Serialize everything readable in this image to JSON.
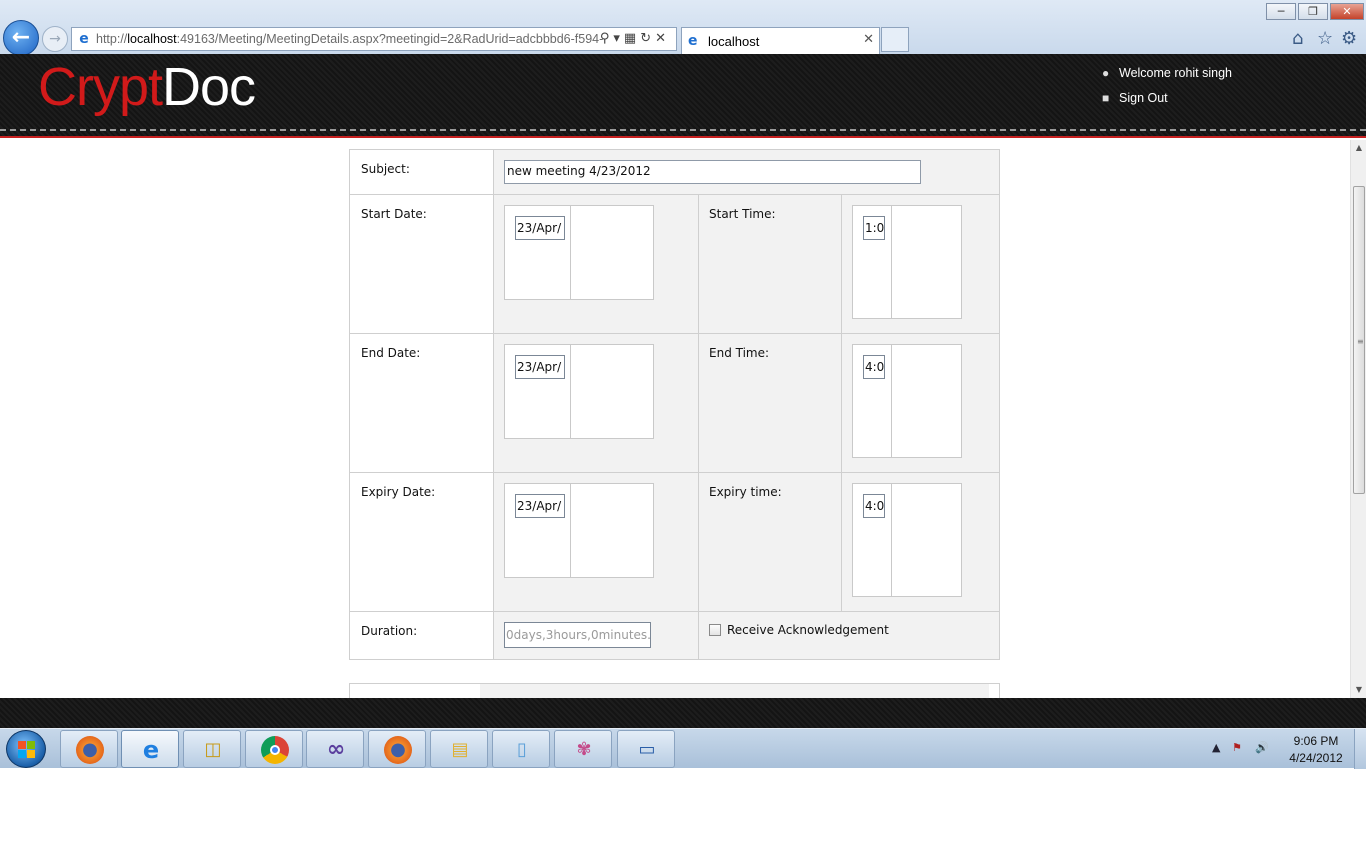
{
  "browser": {
    "url_prefix": "http://",
    "url_host": "localhost",
    "url_rest": ":49163/Meeting/MeetingDetails.aspx?meetingid=2&RadUrid=adcbbbd6-f594-",
    "tab_title": "localhost"
  },
  "header": {
    "logo_part1": "Crypt",
    "logo_part2": "Doc",
    "welcome": "Welcome rohit singh",
    "signout": "Sign Out"
  },
  "form": {
    "subject_label": "Subject:",
    "subject_value": "new meeting 4/23/2012",
    "start_date_label": "Start Date:",
    "start_date_value": "23/Apr/",
    "start_time_label": "Start Time:",
    "start_time_value": "1:0",
    "end_date_label": "End Date:",
    "end_date_value": "23/Apr/",
    "end_time_label": "End Time:",
    "end_time_value": "4:0",
    "expiry_date_label": "Expiry Date:",
    "expiry_date_value": "23/Apr/",
    "expiry_time_label": "Expiry time:",
    "expiry_time_value": "4:0",
    "duration_label": "Duration:",
    "duration_value": "0days,3hours,0minutes.",
    "ack_label": "Receive Acknowledgement"
  },
  "taskbar": {
    "clock_time": "9:06 PM",
    "clock_date": "4/24/2012",
    "apps": [
      "firefox-icon",
      "internet-explorer-icon",
      "database-tools-icon",
      "chrome-icon",
      "visual-studio-icon",
      "firefox-icon",
      "file-explorer-icon",
      "notepad-icon",
      "paint-icon",
      "remote-desktop-icon"
    ]
  },
  "colors": {
    "brand_red": "#d11a1a",
    "header_bg": "#161616",
    "taskbar_bg": "#b8cde3"
  }
}
